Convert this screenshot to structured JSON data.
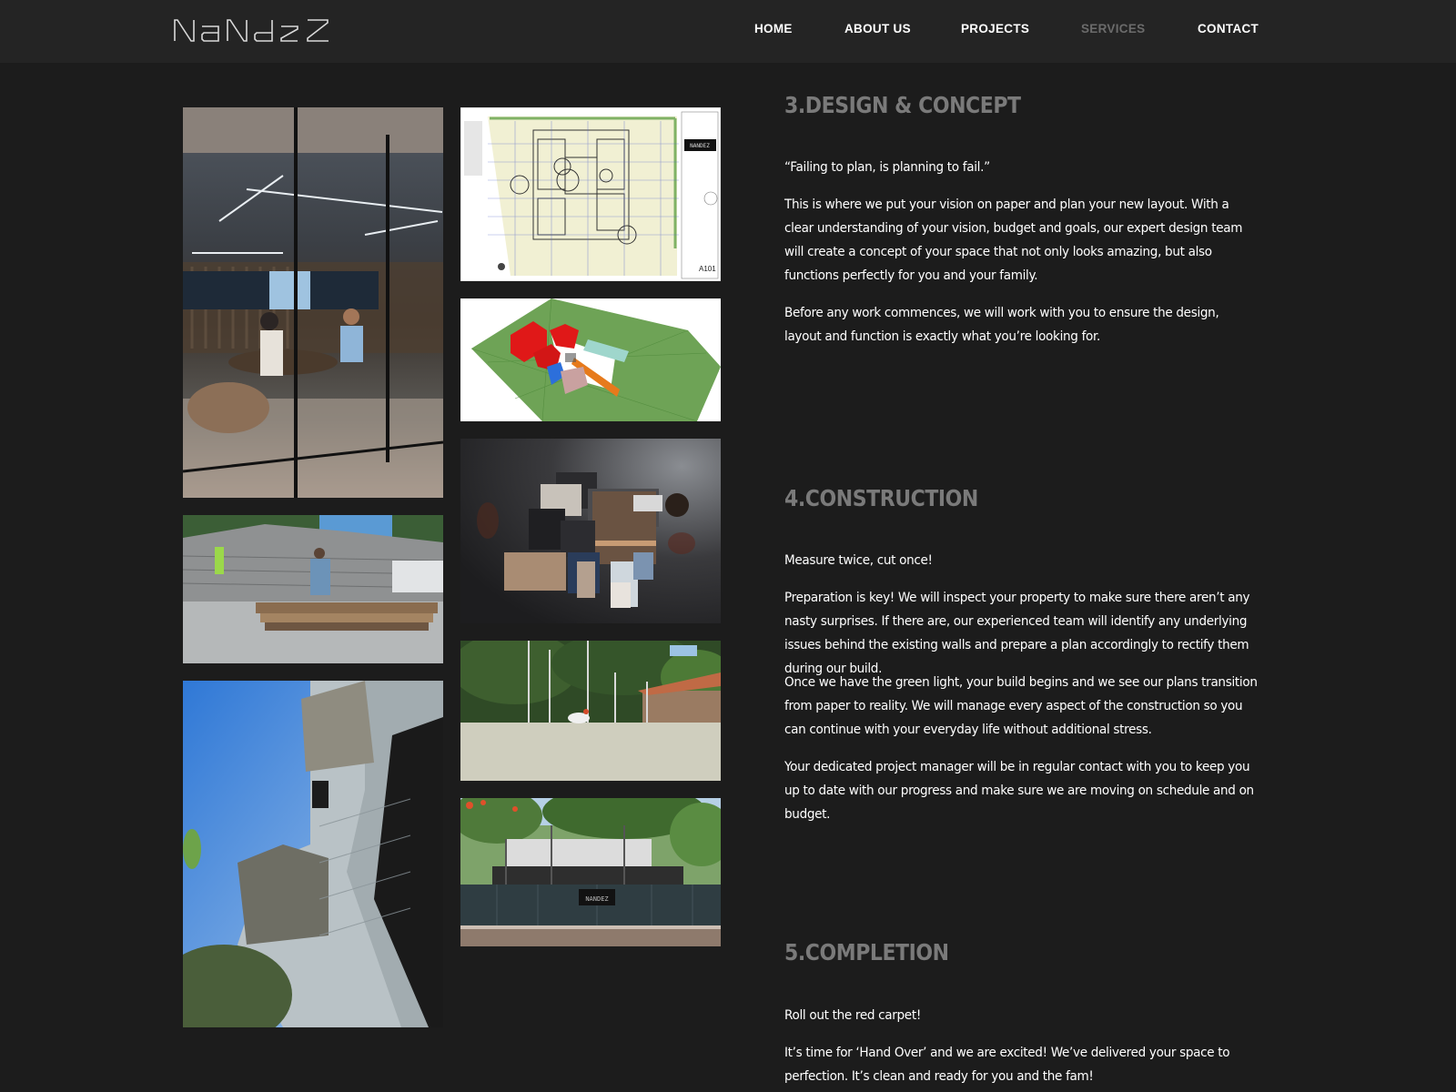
{
  "header": {
    "logo_text": "NANDEZ",
    "nav": [
      {
        "label": "HOME",
        "active": false
      },
      {
        "label": "ABOUT US",
        "active": false
      },
      {
        "label": "PROJECTS",
        "active": false
      },
      {
        "label": "SERVICES",
        "active": true
      },
      {
        "label": "CONTACT",
        "active": false
      }
    ]
  },
  "gallery": {
    "left_column": [
      {
        "name": "office-meeting-photo",
        "alt": "Team meeting in glass-walled conference room"
      },
      {
        "name": "construction-lumber-photo",
        "alt": "Worker cutting lumber at construction site"
      },
      {
        "name": "building-facade-photo",
        "alt": "Upward view of concrete block building under construction"
      }
    ],
    "right_column": [
      {
        "name": "floor-plan-drawing",
        "alt": "Architectural floor plan drawing",
        "sheet_label": "A101",
        "logo_text": "NANDEZ"
      },
      {
        "name": "3d-massing-model",
        "alt": "3D massing model of house on green site"
      },
      {
        "name": "material-moodboard-photo",
        "alt": "Material samples moodboard"
      },
      {
        "name": "concrete-slab-photo",
        "alt": "Freshly poured concrete slab with trees"
      },
      {
        "name": "site-fence-photo",
        "alt": "House under construction behind fence with logo banner",
        "banner_text": "NANDEZ"
      }
    ]
  },
  "sections": [
    {
      "title": "3.DESIGN & CONCEPT",
      "paragraphs": [
        "“Failing to plan, is planning to fail.”",
        "This is where we put your vision on paper and plan your new layout. With a clear understanding of your vision, budget and goals, our expert design team will create a concept of your space that not only looks amazing, but also functions perfectly for you and your family.",
        "Before any work commences, we will work with you to ensure the design, layout and function is exactly what you’re looking for."
      ]
    },
    {
      "title": "4.CONSTRUCTION",
      "paragraphs": [
        "Measure twice, cut once!",
        "Preparation is key! We will inspect your property to make sure there aren’t any nasty surprises. If there are, our experienced team will identify any underlying issues behind the existing walls and prepare a plan accordingly to rectify them during our build.",
        "Once we have the green light, your build begins and we see our plans transition from paper to reality. We will manage every aspect of the construction so you can continue with your everyday life without additional stress.",
        "Your dedicated project manager will be in regular contact with you to keep you up to date with our progress and make sure we are moving on schedule and on budget."
      ]
    },
    {
      "title": "5.COMPLETION",
      "paragraphs": [
        "Roll out the red carpet!",
        "It’s time for ‘Hand Over’ and we are excited! We’ve delivered your space to perfection. It’s clean and ready for you and the fam!"
      ]
    }
  ],
  "colors": {
    "page_bg": "#1c1c1c",
    "header_bg": "#242424",
    "nav_text": "#ffffff",
    "nav_active": "#6b6b6b",
    "section_title": "#7a7a7a",
    "body_text": "#ffffff"
  }
}
